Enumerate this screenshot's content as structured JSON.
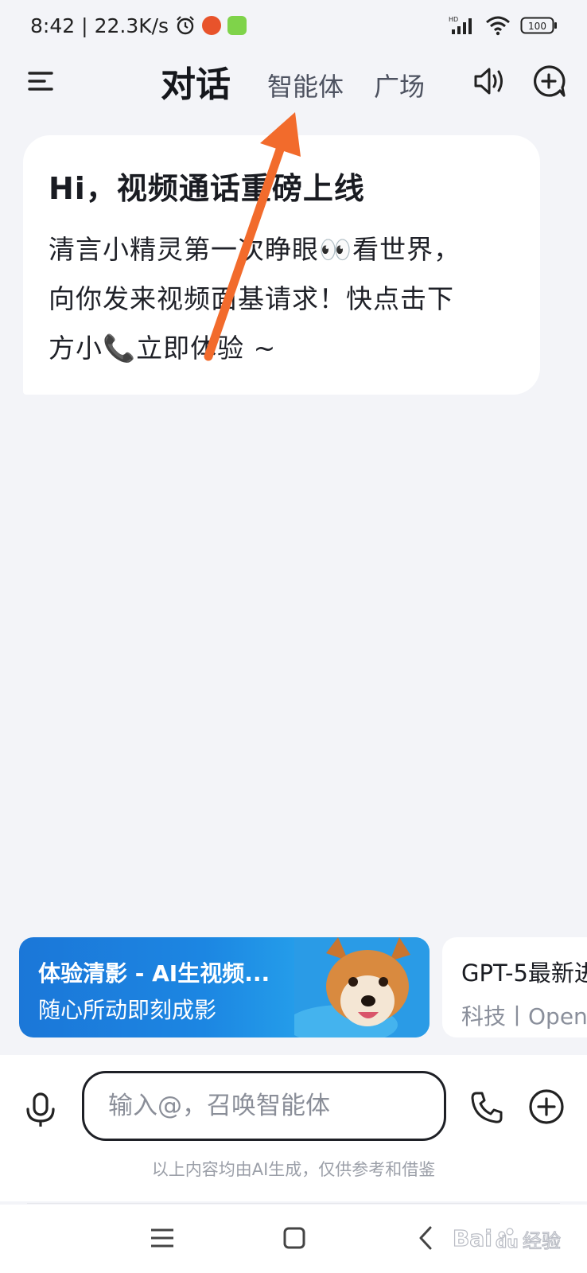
{
  "status_bar": {
    "time": "8:42",
    "net_speed": "22.3K/s",
    "battery": "100",
    "network_badge": "HD",
    "icons": [
      "alarm-icon",
      "app-badge-icon",
      "app-badge-icon",
      "signal-icon",
      "wifi-icon",
      "battery-icon"
    ]
  },
  "header": {
    "tabs": [
      {
        "label": "对话",
        "active": true
      },
      {
        "label": "智能体",
        "active": false
      },
      {
        "label": "广场",
        "active": false
      }
    ],
    "icons": [
      "menu-icon",
      "speaker-icon",
      "new-chat-icon"
    ]
  },
  "welcome": {
    "title": "Hi，视频通话重磅上线",
    "body_lines": [
      "清言小精灵第一次睁眼👀看世界，",
      "向你发来视频面基请求！快点击下",
      "方小📞立即体验 ~"
    ]
  },
  "promos": [
    {
      "title": "体验清影 - AI生视频...",
      "subtitle": "随心所动即刻成影"
    },
    {
      "title": "GPT-5最新进",
      "subtitle": "科技丨Open"
    }
  ],
  "input": {
    "placeholder": "输入@，召唤智能体",
    "value": "",
    "disclaimer": "以上内容均由AI生成，仅供参考和借鉴"
  },
  "nav": {
    "icons": [
      "menu-icon",
      "home-icon",
      "back-icon"
    ]
  },
  "watermark": {
    "brand": "Bai",
    "brand2": "du",
    "tagline": "经验"
  },
  "colors": {
    "background": "#f3f4f8",
    "card": "#ffffff",
    "text_primary": "#1a1c22",
    "text_secondary": "#4d5260",
    "promo_blue": "#1c86e2",
    "annotation_arrow": "#f26b2c"
  }
}
